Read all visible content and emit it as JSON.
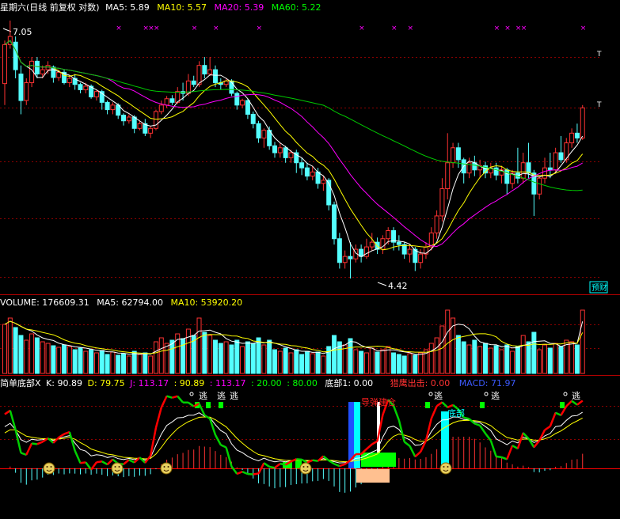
{
  "colors": {
    "background": "#000000",
    "up": "#ff3232",
    "down": "#54ffff",
    "ma5": "#ffffff",
    "ma10": "#ffff00",
    "ma20": "#ff00ff",
    "ma60": "#00c800",
    "grid": "#8c0000",
    "panel_line": "#b40000",
    "kdj_k": "#ffffff",
    "kdj_d": "#ffff00",
    "kdj_j": "#ff00ff",
    "green_line": "#00d000",
    "red_line": "#ff0000"
  },
  "main_panel": {
    "legend": [
      {
        "text": "星期六(日线 前复权 对数)",
        "color": "#ffffff"
      },
      {
        "text": "MA5: 5.89",
        "color": "#ffffff"
      },
      {
        "text": "MA10: 5.57",
        "color": "#ffff00"
      },
      {
        "text": "MA20: 5.39",
        "color": "#ff00ff"
      },
      {
        "text": "MA60: 5.22",
        "color": "#00ff00"
      }
    ],
    "high_label": "7.05",
    "low_label": "4.42",
    "right_markers": [
      "T",
      "T"
    ],
    "watermark": "预财"
  },
  "volume_panel": {
    "legend": [
      {
        "text": "VOLUME: 176609.31",
        "color": "#ffffff"
      },
      {
        "text": "MA5: 62794.00",
        "color": "#ffffff"
      },
      {
        "text": "MA10: 53920.20",
        "color": "#ffff00"
      }
    ]
  },
  "indicator_panel": {
    "legend": [
      {
        "text": "简单底部X",
        "color": "#ffffff"
      },
      {
        "text": "K: 90.89",
        "color": "#ffffff"
      },
      {
        "text": "D: 79.75",
        "color": "#ffff00"
      },
      {
        "text": "J: 113.17",
        "color": "#ff00ff"
      },
      {
        "text": ": 90.89",
        "color": "#ffff00"
      },
      {
        "text": ": 113.17",
        "color": "#ff00ff"
      },
      {
        "text": ": 20.00",
        "color": "#00ff00"
      },
      {
        "text": ": 80.00",
        "color": "#00ff00"
      },
      {
        "text": "底部1: 0.00",
        "color": "#ffffff"
      },
      {
        "text": "猎鹰出击: 0.00",
        "color": "#ff3232"
      },
      {
        "text": "MACD: 71.97",
        "color": "#3c5aff"
      }
    ],
    "labels": {
      "escape": "逃",
      "bottom": "底部",
      "guide": "导弹建仓"
    }
  },
  "chart_data": {
    "type": "candlestick",
    "price_axis": {
      "scale": "log",
      "high": 7.05,
      "low": 4.42
    },
    "volume_legend": {
      "VOLUME": 176609.31,
      "MA5": 62794.0,
      "MA10": 53920.2
    },
    "candles": [
      [
        6.29,
        6.75,
        6.8,
        6.05
      ],
      [
        6.75,
        6.85,
        7.05,
        6.7
      ],
      [
        6.78,
        6.45,
        6.85,
        6.35
      ],
      [
        6.4,
        6.1,
        6.5,
        5.95
      ],
      [
        6.1,
        6.3,
        6.35,
        6.05
      ],
      [
        6.3,
        6.55,
        6.6,
        6.25
      ],
      [
        6.55,
        6.4,
        6.6,
        6.35
      ],
      [
        6.4,
        6.45,
        6.5,
        6.35
      ],
      [
        6.45,
        6.5,
        6.55,
        6.4
      ],
      [
        6.48,
        6.36,
        6.5,
        6.3
      ],
      [
        6.36,
        6.42,
        6.45,
        6.32
      ],
      [
        6.42,
        6.3,
        6.45,
        6.28
      ],
      [
        6.3,
        6.35,
        6.38,
        6.25
      ],
      [
        6.35,
        6.28,
        6.4,
        6.22
      ],
      [
        6.28,
        6.22,
        6.3,
        6.18
      ],
      [
        6.22,
        6.26,
        6.3,
        6.18
      ],
      [
        6.26,
        6.14,
        6.28,
        6.12
      ],
      [
        6.14,
        6.2,
        6.22,
        6.1
      ],
      [
        6.2,
        6.08,
        6.22,
        6.0
      ],
      [
        6.08,
        6.0,
        6.1,
        5.95
      ],
      [
        6.0,
        6.05,
        6.08,
        5.95
      ],
      [
        6.05,
        5.94,
        6.07,
        5.9
      ],
      [
        5.94,
        5.88,
        5.96,
        5.83
      ],
      [
        5.88,
        5.92,
        5.95,
        5.85
      ],
      [
        5.92,
        5.8,
        5.94,
        5.75
      ],
      [
        5.8,
        5.85,
        5.88,
        5.78
      ],
      [
        5.85,
        5.75,
        5.9,
        5.72
      ],
      [
        5.75,
        5.8,
        5.82,
        5.7
      ],
      [
        5.8,
        5.98,
        6.0,
        5.78
      ],
      [
        5.98,
        6.05,
        6.1,
        5.95
      ],
      [
        6.05,
        6.12,
        6.15,
        6.02
      ],
      [
        6.12,
        6.08,
        6.16,
        6.05
      ],
      [
        6.08,
        6.2,
        6.25,
        6.06
      ],
      [
        6.2,
        6.18,
        6.3,
        6.1
      ],
      [
        6.18,
        6.32,
        6.4,
        6.15
      ],
      [
        6.32,
        6.28,
        6.38,
        6.25
      ],
      [
        6.28,
        6.5,
        6.55,
        6.25
      ],
      [
        6.5,
        6.4,
        6.6,
        6.35
      ],
      [
        6.4,
        6.45,
        6.6,
        6.38
      ],
      [
        6.45,
        6.3,
        6.5,
        6.25
      ],
      [
        6.3,
        6.28,
        6.35,
        6.22
      ],
      [
        6.28,
        6.32,
        6.35,
        6.25
      ],
      [
        6.32,
        6.18,
        6.34,
        6.15
      ],
      [
        6.18,
        6.05,
        6.2,
        6.0
      ],
      [
        6.05,
        6.1,
        6.12,
        6.02
      ],
      [
        6.1,
        5.95,
        6.12,
        5.9
      ],
      [
        5.95,
        5.85,
        5.98,
        5.8
      ],
      [
        5.85,
        5.7,
        5.88,
        5.65
      ],
      [
        5.7,
        5.78,
        5.8,
        5.6
      ],
      [
        5.78,
        5.62,
        5.82,
        5.58
      ],
      [
        5.62,
        5.55,
        5.66,
        5.5
      ],
      [
        5.55,
        5.6,
        5.65,
        5.5
      ],
      [
        5.6,
        5.5,
        5.62,
        5.45
      ],
      [
        5.5,
        5.55,
        5.58,
        5.45
      ],
      [
        5.55,
        5.45,
        5.58,
        5.35
      ],
      [
        5.45,
        5.4,
        5.5,
        5.33
      ],
      [
        5.4,
        5.32,
        5.45,
        5.28
      ],
      [
        5.32,
        5.36,
        5.42,
        5.28
      ],
      [
        5.36,
        5.25,
        5.4,
        5.2
      ],
      [
        5.25,
        5.28,
        5.32,
        5.18
      ],
      [
        5.28,
        5.05,
        5.3,
        5.0
      ],
      [
        5.05,
        4.75,
        5.08,
        4.7
      ],
      [
        4.75,
        4.55,
        4.8,
        4.5
      ],
      [
        4.55,
        4.6,
        4.65,
        4.5
      ],
      [
        4.6,
        4.58,
        4.72,
        4.42
      ],
      [
        4.58,
        4.66,
        4.7,
        4.55
      ],
      [
        4.66,
        4.6,
        4.7,
        4.55
      ],
      [
        4.6,
        4.68,
        4.75,
        4.58
      ],
      [
        4.68,
        4.72,
        4.8,
        4.65
      ],
      [
        4.72,
        4.66,
        4.76,
        4.62
      ],
      [
        4.66,
        4.75,
        4.78,
        4.62
      ],
      [
        4.75,
        4.82,
        4.85,
        4.7
      ],
      [
        4.82,
        4.72,
        4.85,
        4.65
      ],
      [
        4.72,
        4.7,
        4.78,
        4.65
      ],
      [
        4.7,
        4.62,
        4.72,
        4.58
      ],
      [
        4.62,
        4.66,
        4.7,
        4.55
      ],
      [
        4.66,
        4.55,
        4.68,
        4.48
      ],
      [
        4.55,
        4.62,
        4.66,
        4.5
      ],
      [
        4.62,
        4.68,
        4.72,
        4.58
      ],
      [
        4.68,
        4.8,
        4.85,
        4.65
      ],
      [
        4.8,
        4.95,
        5.0,
        4.75
      ],
      [
        4.95,
        5.2,
        5.3,
        4.9
      ],
      [
        5.2,
        5.45,
        5.75,
        5.1
      ],
      [
        5.45,
        5.6,
        5.65,
        5.4
      ],
      [
        5.6,
        5.48,
        5.65,
        5.4
      ],
      [
        5.48,
        5.35,
        5.5,
        5.25
      ],
      [
        5.35,
        5.45,
        5.5,
        5.3
      ],
      [
        5.45,
        5.38,
        5.52,
        5.32
      ],
      [
        5.38,
        5.42,
        5.48,
        5.3
      ],
      [
        5.42,
        5.35,
        5.46,
        5.3
      ],
      [
        5.35,
        5.4,
        5.45,
        5.3
      ],
      [
        5.4,
        5.33,
        5.45,
        5.28
      ],
      [
        5.33,
        5.38,
        5.42,
        5.25
      ],
      [
        5.38,
        5.25,
        5.4,
        5.15
      ],
      [
        5.25,
        5.35,
        5.38,
        5.2
      ],
      [
        5.35,
        5.3,
        5.6,
        5.25
      ],
      [
        5.3,
        5.45,
        5.55,
        5.25
      ],
      [
        5.45,
        5.35,
        5.65,
        5.3
      ],
      [
        5.35,
        5.15,
        5.38,
        4.95
      ],
      [
        5.15,
        5.3,
        5.32,
        5.1
      ],
      [
        5.3,
        5.4,
        5.5,
        5.25
      ],
      [
        5.4,
        5.38,
        5.55,
        5.3
      ],
      [
        5.38,
        5.55,
        5.6,
        5.35
      ],
      [
        5.55,
        5.48,
        5.72,
        5.45
      ],
      [
        5.48,
        5.65,
        5.7,
        5.45
      ],
      [
        5.65,
        5.75,
        5.8,
        5.6
      ],
      [
        5.75,
        5.7,
        5.85,
        5.65
      ],
      [
        5.7,
        6.02,
        6.05,
        5.68
      ]
    ],
    "volumes": [
      62000,
      70000,
      58000,
      48000,
      42000,
      50000,
      45000,
      40000,
      38000,
      35000,
      33000,
      36000,
      34000,
      30000,
      32000,
      28000,
      30000,
      26000,
      29000,
      24000,
      27000,
      23000,
      25000,
      22000,
      28000,
      24000,
      26000,
      22000,
      40000,
      45000,
      38000,
      42000,
      50000,
      44000,
      56000,
      48000,
      70000,
      52000,
      48000,
      42000,
      38000,
      40000,
      36000,
      42000,
      34000,
      40000,
      38000,
      45000,
      36000,
      42000,
      30000,
      28000,
      32000,
      26000,
      30000,
      24000,
      28000,
      25000,
      27000,
      22000,
      34000,
      48000,
      40000,
      36000,
      44000,
      30000,
      28000,
      26000,
      32000,
      27000,
      30000,
      34000,
      26000,
      24000,
      22000,
      25000,
      23000,
      26000,
      30000,
      38000,
      45000,
      60000,
      88000,
      70000,
      48000,
      40000,
      36000,
      42000,
      34000,
      38000,
      32000,
      35000,
      30000,
      36000,
      28000,
      34000,
      48000,
      40000,
      52000,
      30000,
      36000,
      32000,
      38000,
      34000,
      42000,
      40000,
      36000,
      176609
    ],
    "indicator": {
      "K": 90.89,
      "D": 79.75,
      "J": 113.17,
      "bottom1": 0.0,
      "falcon_strike": 0.0,
      "MACD": 71.97
    }
  }
}
